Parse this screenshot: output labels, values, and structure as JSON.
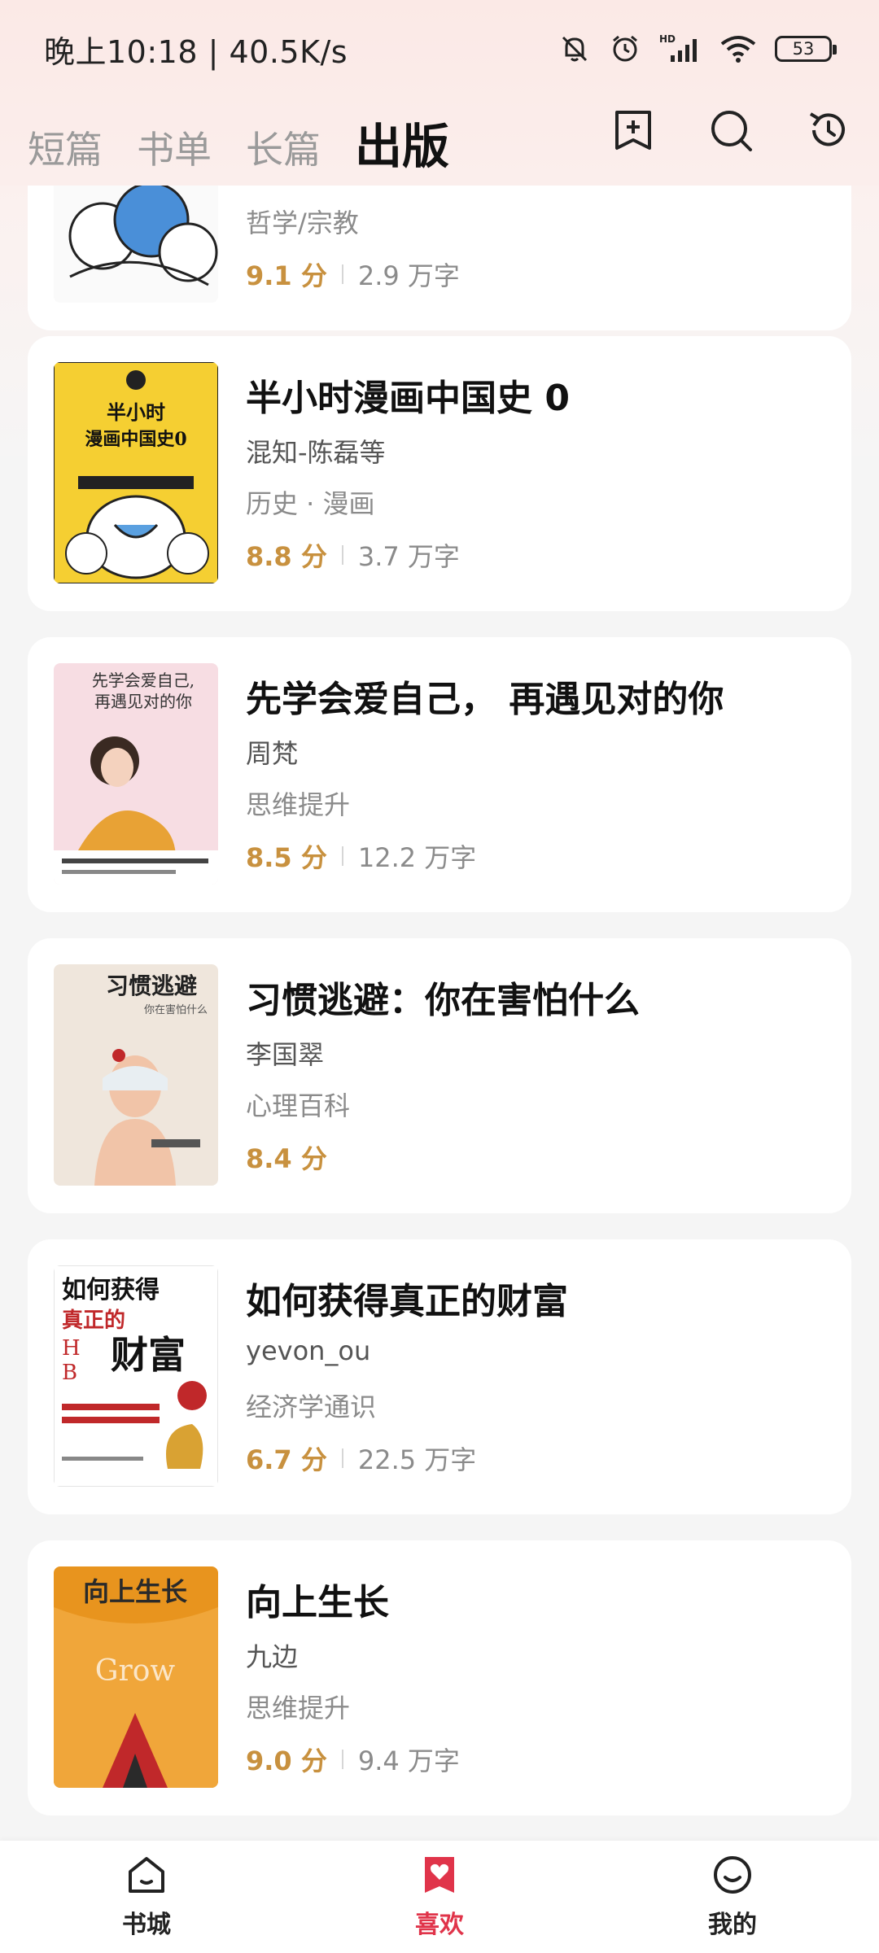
{
  "status_bar": {
    "time": "晚上10:18 | 40.5K/s",
    "battery": "53"
  },
  "header": {
    "tabs": [
      {
        "label": "短篇"
      },
      {
        "label": "书单"
      },
      {
        "label": "长篇"
      },
      {
        "label": "出版"
      }
    ],
    "active_tab": "出版",
    "icons": [
      "add-bookmark-icon",
      "search-icon",
      "history-icon"
    ]
  },
  "books": [
    {
      "title": "",
      "author": "",
      "category": "哲学/宗教",
      "score": "9.1 分",
      "words": "2.9 万字",
      "cover_color": "#4a8fd8"
    },
    {
      "title": "半小时漫画中国史 0",
      "author": "混知-陈磊等",
      "category": "历史 · 漫画",
      "score": "8.8 分",
      "words": "3.7 万字",
      "cover_color": "#f5cf32"
    },
    {
      "title": "先学会爱自己， 再遇见对的你",
      "author": "周梵",
      "category": "思维提升",
      "score": "8.5 分",
      "words": "12.2 万字",
      "cover_color": "#f7dde3"
    },
    {
      "title": "习惯逃避：你在害怕什么",
      "author": "李国翠",
      "category": "心理百科",
      "score": "8.4 分",
      "words": "",
      "cover_color": "#efe6dc"
    },
    {
      "title": "如何获得真正的财富",
      "author": "yevon_ou",
      "category": "经济学通识",
      "score": "6.7 分",
      "words": "22.5 万字",
      "cover_color": "#ffffff"
    },
    {
      "title": "向上生长",
      "author": "九边",
      "category": "思维提升",
      "score": "9.0 分",
      "words": "9.4 万字",
      "cover_color": "#e8941e"
    }
  ],
  "bottom_nav": {
    "items": [
      {
        "label": "书城",
        "icon": "home-icon"
      },
      {
        "label": "喜欢",
        "icon": "heart-bookmark-icon"
      },
      {
        "label": "我的",
        "icon": "smile-face-icon"
      }
    ],
    "active": "喜欢"
  },
  "colors": {
    "accent": "#e0344a",
    "score": "#c8913f"
  }
}
